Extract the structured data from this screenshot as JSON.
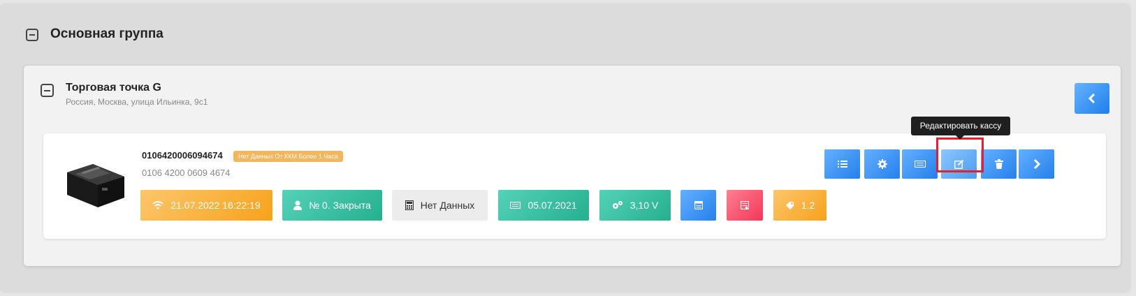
{
  "group": {
    "title": "Основная группа"
  },
  "point": {
    "title": "Торговая точка G",
    "address": "Россия, Москва, улица Ильинка, 9с1"
  },
  "device": {
    "id": "0106420006094674",
    "id_formatted": "0106 4200 0609 4674",
    "warning_badge": "Нет Данных От ККМ Более 1 Часа",
    "statuses": {
      "connection": {
        "text": "21.07.2022 16:22:19",
        "icon": "wifi-icon"
      },
      "shift": {
        "text": "№ 0. Закрыта",
        "icon": "user-icon"
      },
      "fiscal": {
        "text": "Нет Данных",
        "icon": "calculator-icon"
      },
      "date": {
        "text": "05.07.2021",
        "icon": "keyboard-icon"
      },
      "voltage": {
        "text": "3,10 V",
        "icon": "gears-icon"
      },
      "window": {
        "text": "",
        "icon": "window-icon"
      },
      "receipt": {
        "text": "",
        "icon": "receipt-icon"
      },
      "version": {
        "text": "1.2",
        "icon": "tag-icon"
      }
    },
    "actions": [
      "list-icon",
      "gear-icon",
      "keyboard-icon",
      "edit-icon",
      "trash-icon",
      "chevron-right-icon"
    ]
  },
  "tooltip": {
    "text": "Редактировать кассу"
  },
  "colors": {
    "blue": "#2580ec",
    "teal": "#25b08e",
    "orange": "#f7a21b",
    "pink": "#f2375a",
    "highlight": "#e5202e"
  }
}
